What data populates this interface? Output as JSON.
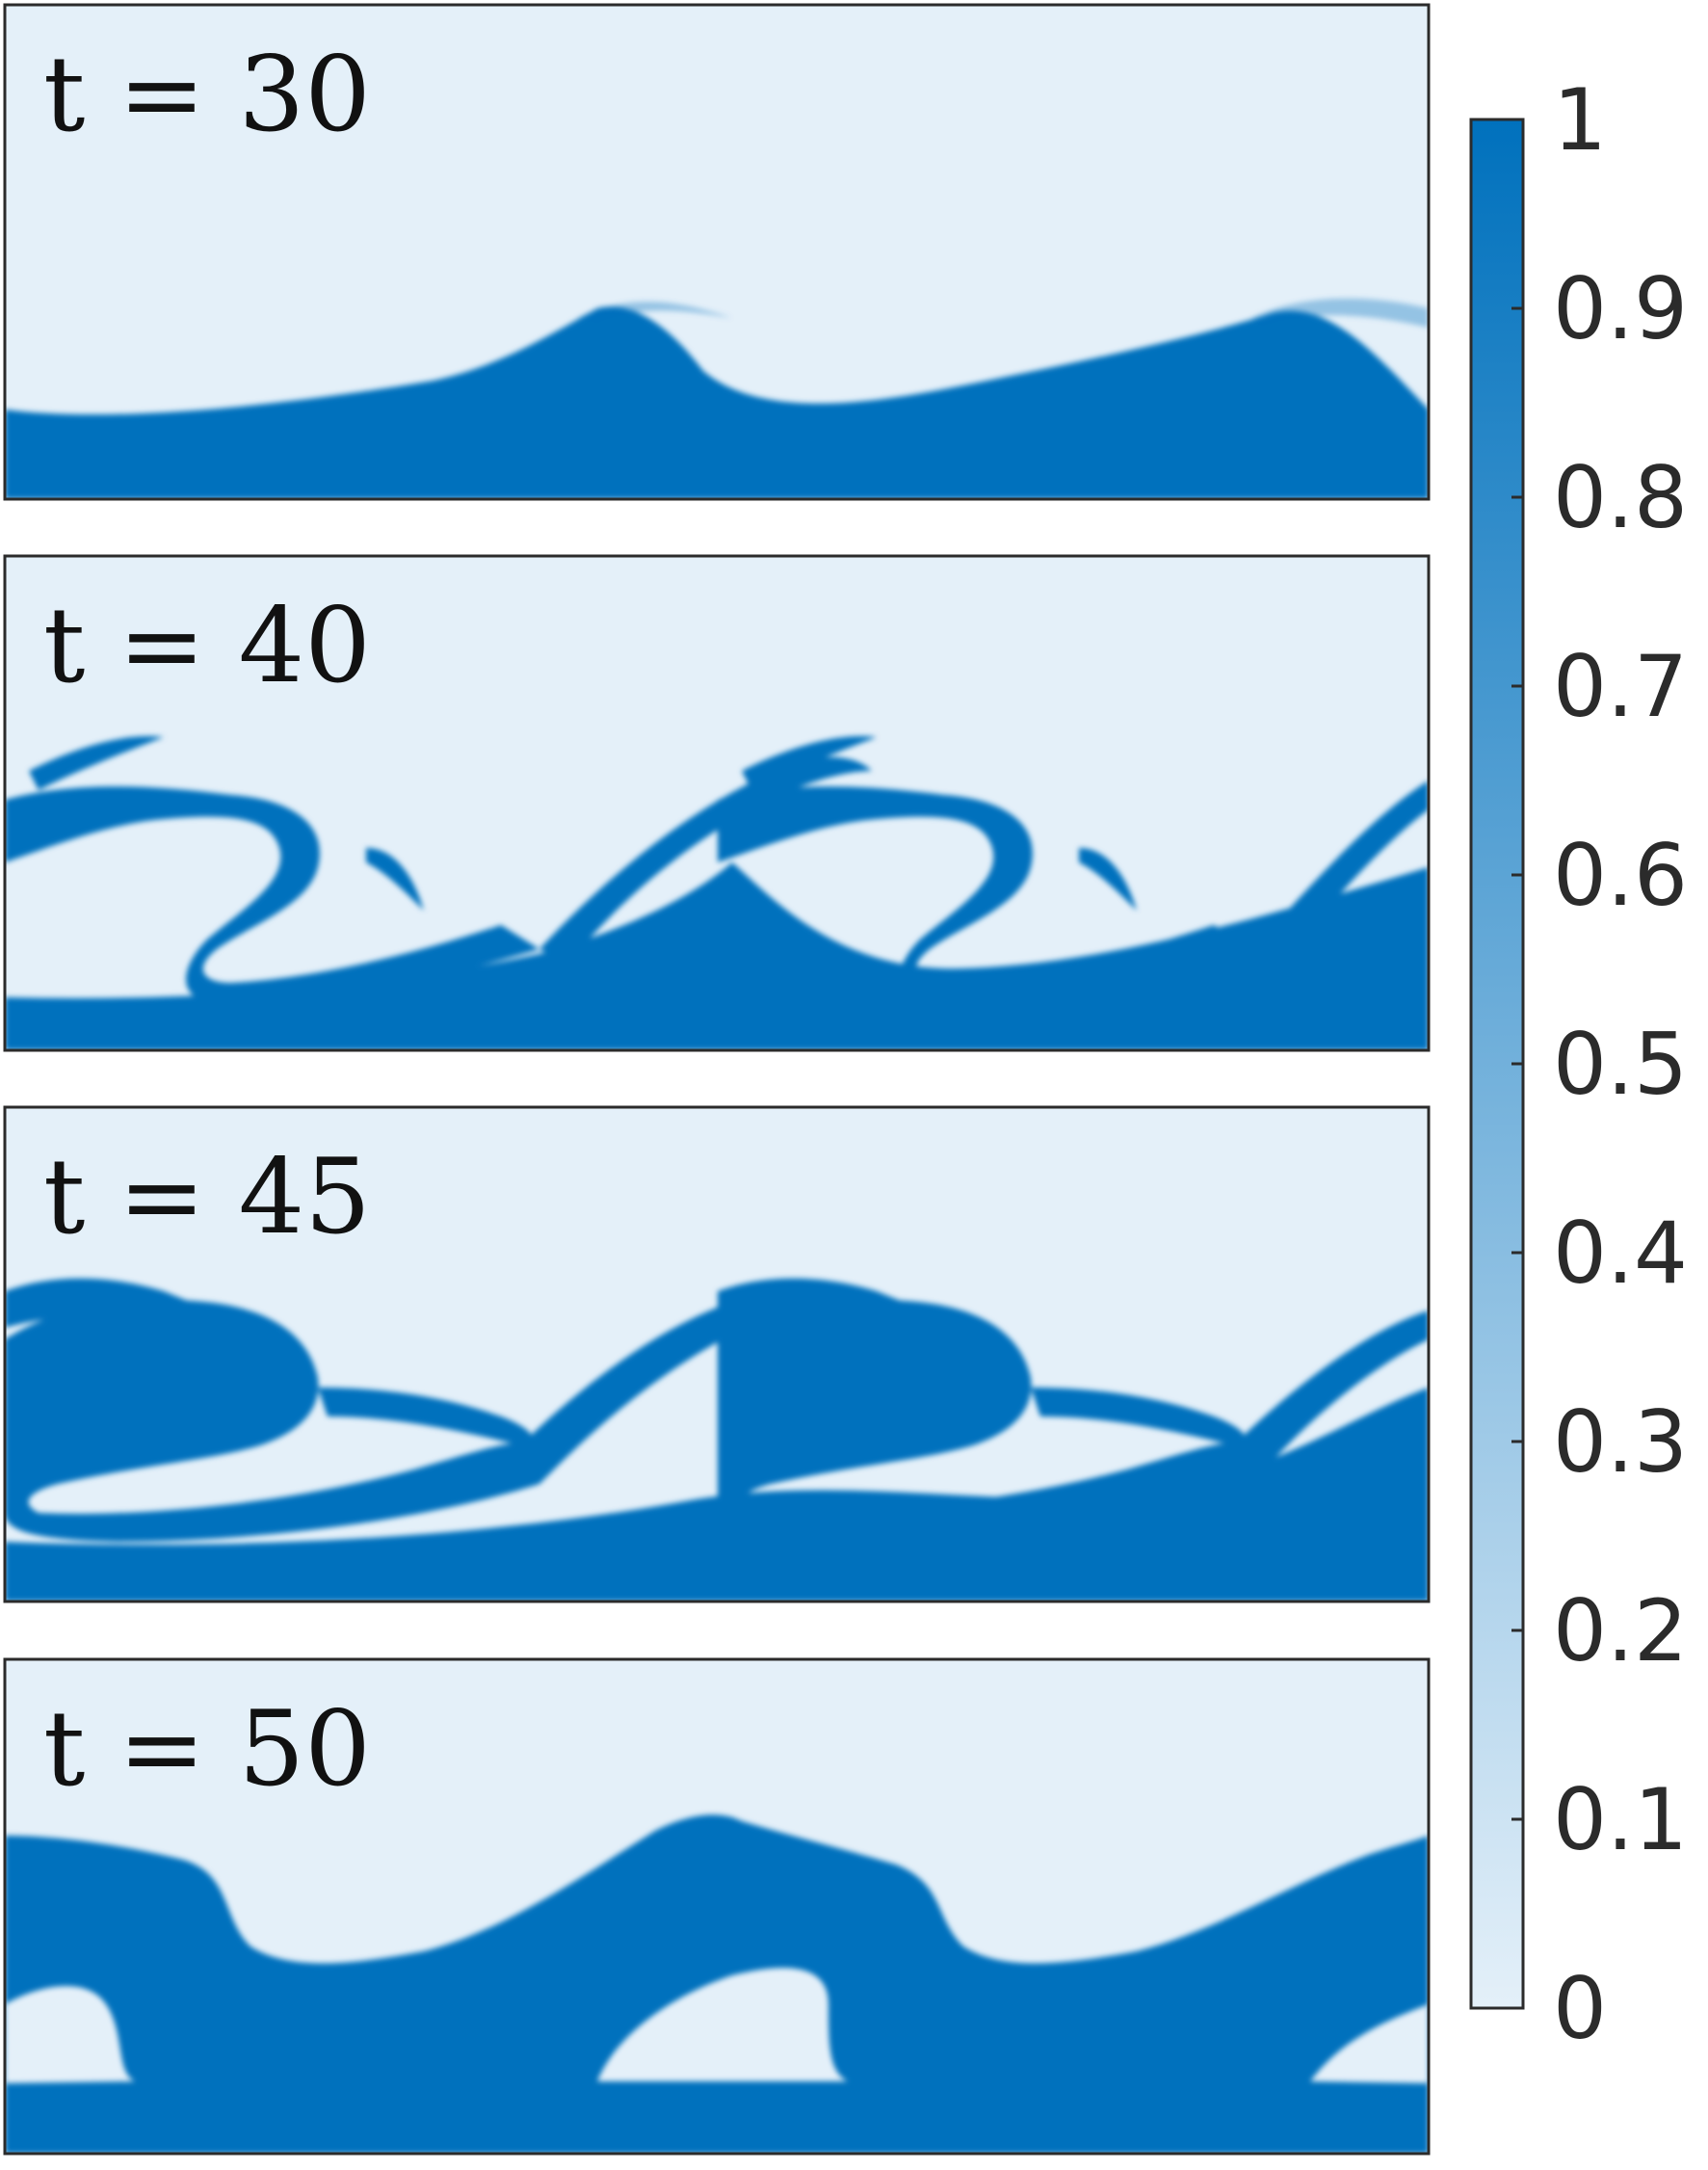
{
  "chart_data": {
    "type": "heatmap",
    "colormap": {
      "low": "#e4f0f9",
      "high": "#0071bd"
    },
    "value_range": [
      0,
      1
    ],
    "colorbar": {
      "orientation": "vertical",
      "ticks": [
        {
          "value": 0,
          "label": "0"
        },
        {
          "value": 0.1,
          "label": "0.1"
        },
        {
          "value": 0.2,
          "label": "0.2"
        },
        {
          "value": 0.3,
          "label": "0.3"
        },
        {
          "value": 0.4,
          "label": "0.4"
        },
        {
          "value": 0.5,
          "label": "0.5"
        },
        {
          "value": 0.6,
          "label": "0.6"
        },
        {
          "value": 0.7,
          "label": "0.7"
        },
        {
          "value": 0.8,
          "label": "0.8"
        },
        {
          "value": 0.9,
          "label": "0.9"
        },
        {
          "value": 1,
          "label": "1"
        }
      ]
    },
    "panels": [
      {
        "label": "t = 30",
        "t": 30
      },
      {
        "label": "t = 40",
        "t": 40
      },
      {
        "label": "t = 45",
        "t": 45
      },
      {
        "label": "t = 50",
        "t": 50
      }
    ]
  }
}
